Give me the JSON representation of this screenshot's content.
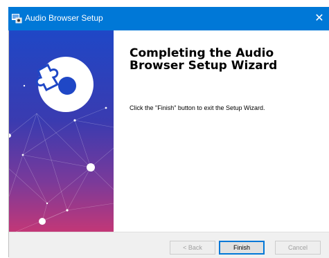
{
  "window": {
    "title": "Audio Browser Setup",
    "close_glyph": "✕",
    "accent_color": "#0078d7"
  },
  "icons": {
    "app": "installer-app-icon",
    "close": "close-icon",
    "banner": "puzzle-disc-logo"
  },
  "content": {
    "heading": "Completing the Audio Browser Setup Wizard",
    "message": "Click the \"Finish\" button to exit the Setup Wizard."
  },
  "buttons": {
    "back": "< Back",
    "finish": "Finish",
    "cancel": "Cancel"
  },
  "colors": {
    "banner_top": "#1f47c6",
    "banner_bottom": "#c23777"
  }
}
